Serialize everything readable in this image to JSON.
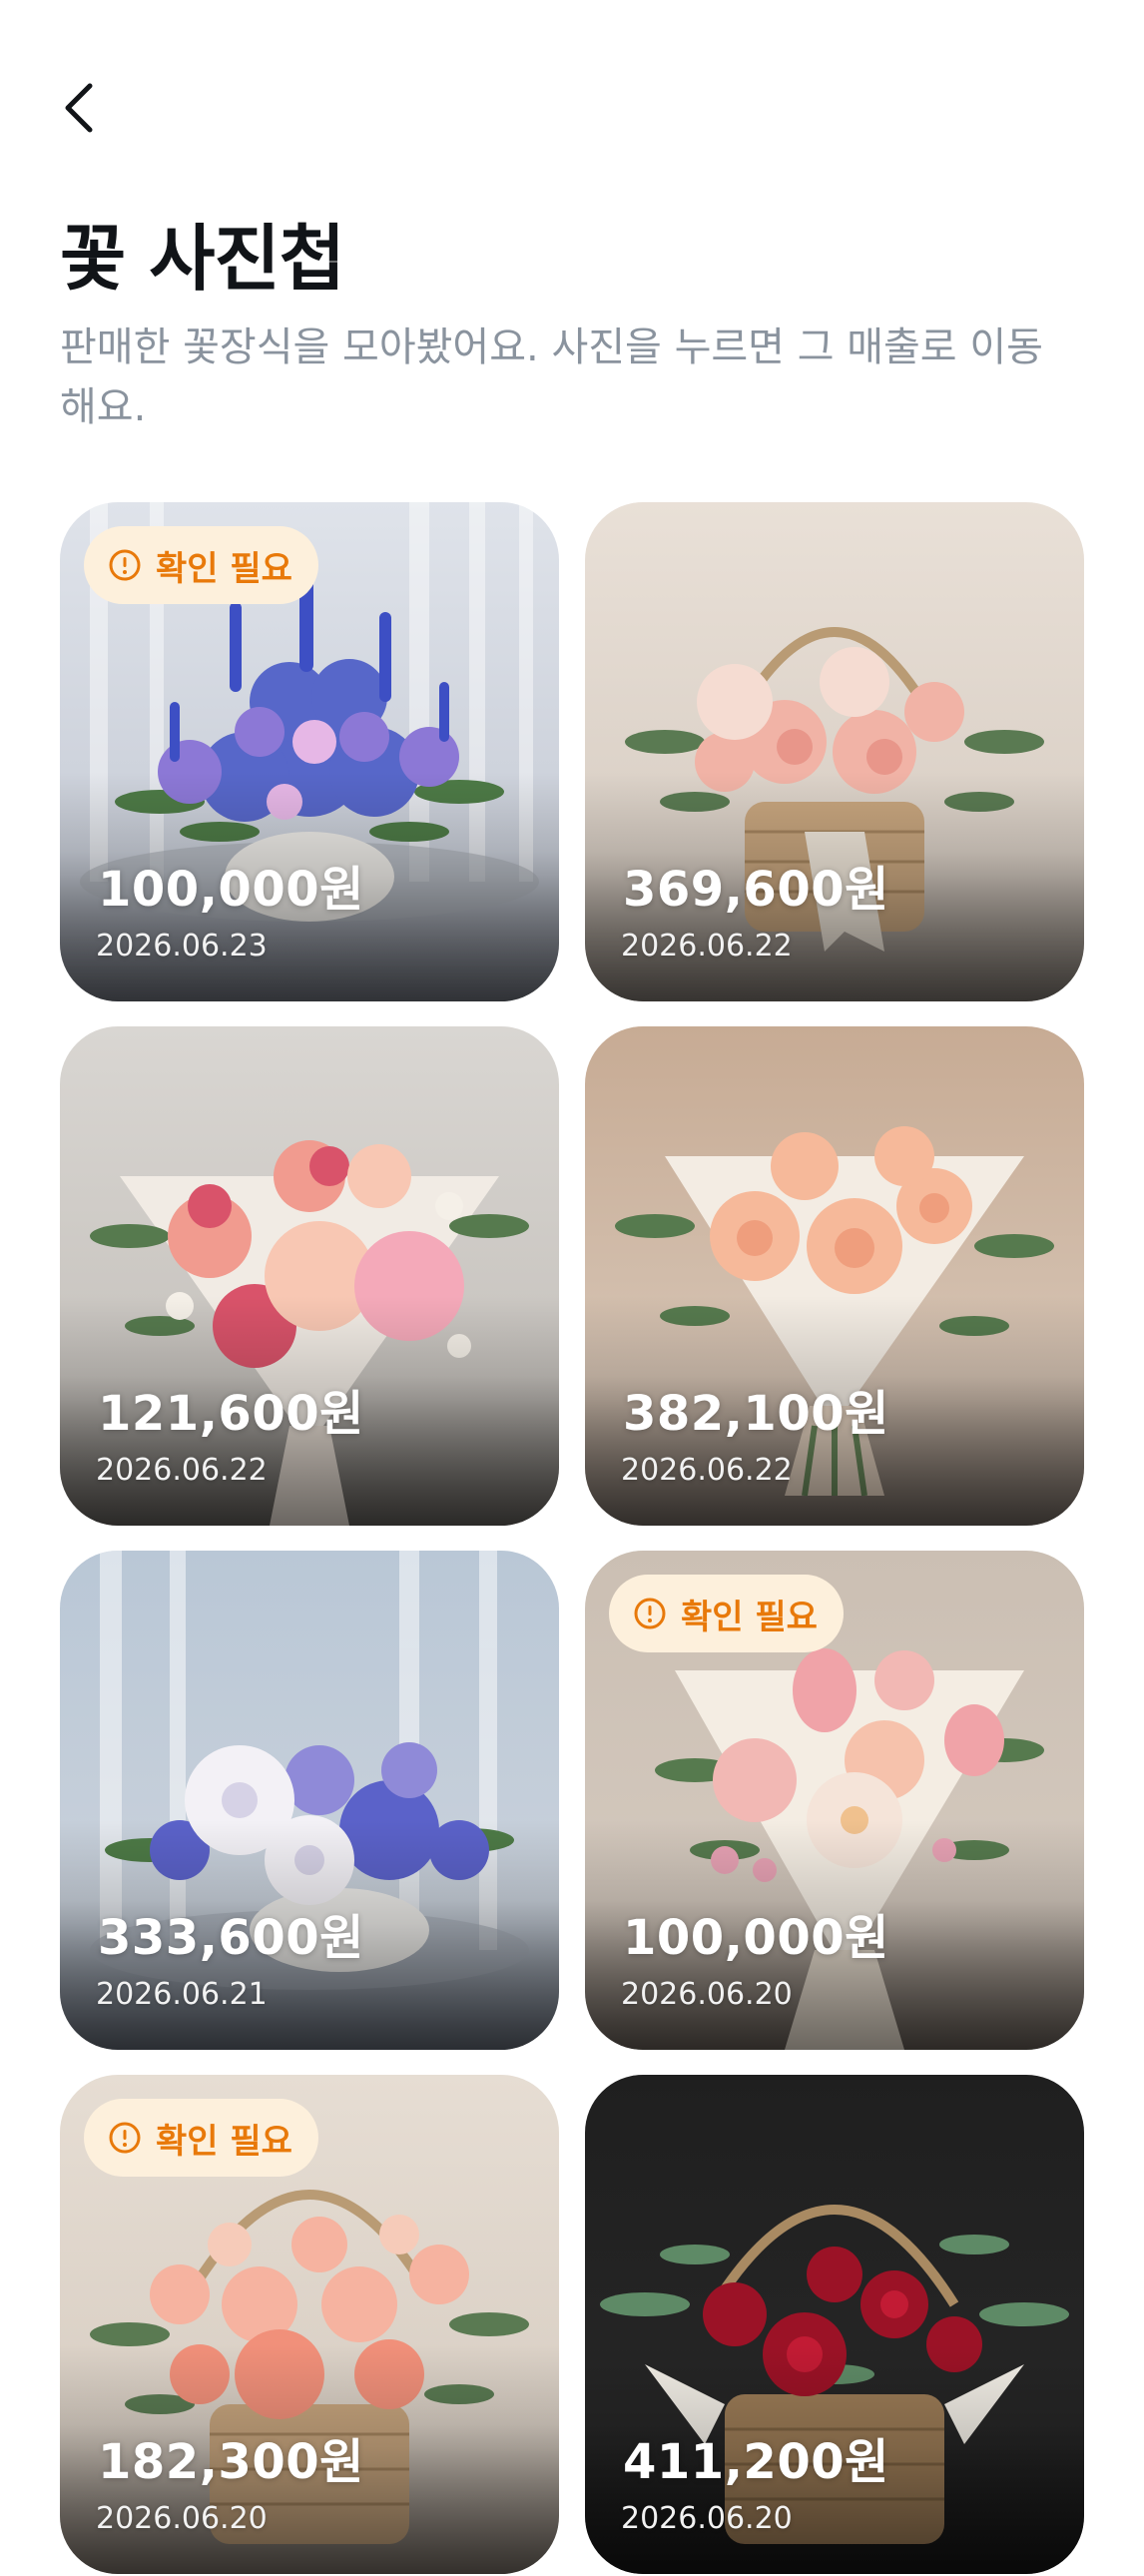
{
  "header": {
    "back_icon": "chevron-left-icon",
    "title": "꽃 사진첩",
    "description": "판매한 꽃장식을 모아봤어요. 사진을 누르면 그 매출로 이동해요."
  },
  "colors": {
    "badge_bg": "#fdf0dc",
    "badge_accent": "#e8790a",
    "title": "#111418",
    "description": "#8a939e"
  },
  "photos": [
    {
      "price": "100,000원",
      "date": "2026.06.23",
      "badge": "확인 필요",
      "needs_check": true
    },
    {
      "price": "369,600원",
      "date": "2026.06.22",
      "needs_check": false
    },
    {
      "price": "121,600원",
      "date": "2026.06.22",
      "needs_check": false
    },
    {
      "price": "382,100원",
      "date": "2026.06.22",
      "needs_check": false
    },
    {
      "price": "333,600원",
      "date": "2026.06.21",
      "needs_check": false
    },
    {
      "price": "100,000원",
      "date": "2026.06.20",
      "badge": "확인 필요",
      "needs_check": true
    },
    {
      "price": "182,300원",
      "date": "2026.06.20",
      "badge": "확인 필요",
      "needs_check": true
    },
    {
      "price": "411,200원",
      "date": "2026.06.20",
      "needs_check": false
    }
  ]
}
